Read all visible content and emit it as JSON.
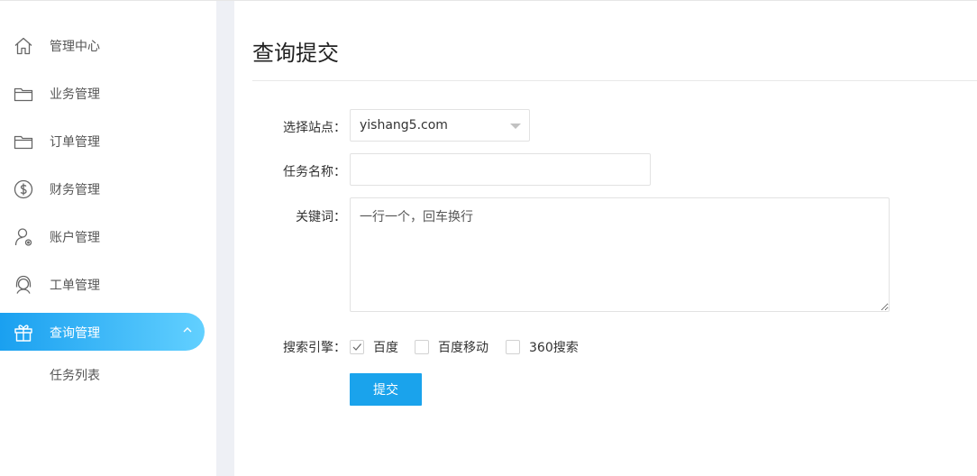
{
  "sidebar": {
    "items": [
      {
        "label": "管理中心",
        "icon": "home-icon"
      },
      {
        "label": "业务管理",
        "icon": "folder-icon"
      },
      {
        "label": "订单管理",
        "icon": "folder-icon"
      },
      {
        "label": "财务管理",
        "icon": "dollar-icon"
      },
      {
        "label": "账户管理",
        "icon": "user-settings-icon"
      },
      {
        "label": "工单管理",
        "icon": "headset-icon"
      },
      {
        "label": "查询管理",
        "icon": "gift-icon",
        "active": true,
        "expanded": true
      }
    ],
    "subitems": [
      {
        "label": "任务列表"
      }
    ],
    "accent_color": "#1aa0f0"
  },
  "main": {
    "title": "查询提交",
    "form": {
      "site_label": "选择站点：",
      "site_value": "yishang5.com",
      "task_name_label": "任务名称：",
      "task_name_value": "",
      "keywords_label": "关键词：",
      "keywords_placeholder": "一行一个，回车换行",
      "engine_label": "搜索引擎：",
      "engines": [
        {
          "label": "百度",
          "checked": true
        },
        {
          "label": "百度移动",
          "checked": false
        },
        {
          "label": "360搜索",
          "checked": false
        }
      ],
      "submit_label": "提交",
      "submit_color": "#1aa3ec"
    }
  }
}
